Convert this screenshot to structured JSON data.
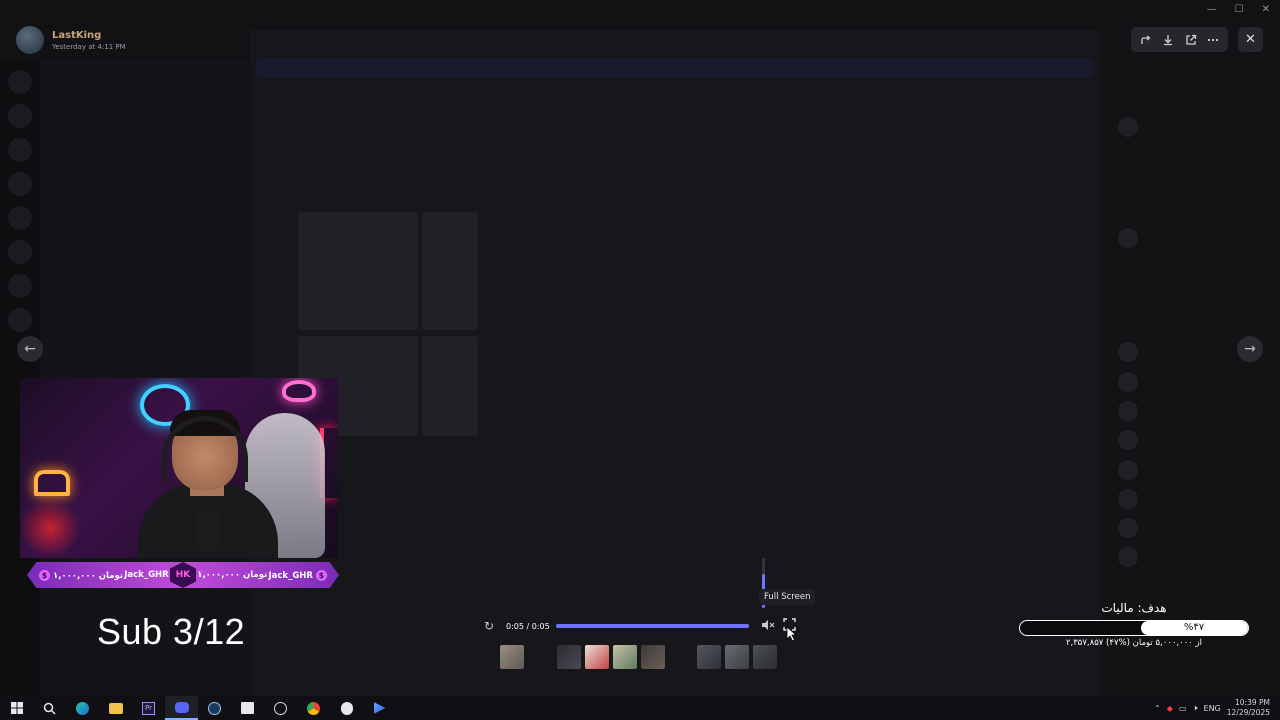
{
  "author": {
    "name": "LastKing",
    "timestamp": "Yesterday at 4:11 PM"
  },
  "toolbar": {
    "icons": [
      "forward-icon",
      "download-icon",
      "open-external-icon",
      "more-icon"
    ],
    "close_glyph": "✕"
  },
  "window_controls": {
    "minimize": "—",
    "maximize": "☐",
    "close": "✕"
  },
  "nav": {
    "prev_glyph": "←",
    "next_glyph": "→"
  },
  "stream_overlay": {
    "ticker": {
      "left_amount": "۱,۰۰۰,۰۰۰ تومان",
      "left_name": "Jack_GHR",
      "logo": "HK",
      "right_amount": "۱,۰۰۰,۰۰۰ تومان",
      "right_name": "Jack_GHR",
      "coin": "$"
    },
    "sub_counter": "Sub 3/12"
  },
  "video": {
    "time": "0:05 / 0:05",
    "progress": 1.0,
    "volume": 0.68,
    "tooltip": "Full Screen",
    "replay_glyph": "↻",
    "mute_glyph": "🔇",
    "fullscreen_glyph": "⛶"
  },
  "goal": {
    "title": "هدف: مالیات",
    "percent_label": "%۴۷",
    "fraction": 0.47,
    "detail": "۲,۳۵۷,۸۵۷ از ۵,۰۰۰,۰۰۰ تومان (%۴۷)"
  },
  "taskbar": {
    "apps": [
      "start",
      "search",
      "edge",
      "explorer",
      "premiere",
      "discord",
      "steam",
      "store",
      "obs",
      "chrome",
      "app",
      "app2"
    ],
    "language": "ENG",
    "time": "10:39 PM",
    "date": "12/29/2025"
  },
  "colors": {
    "accent": "#6f73ff",
    "ticker": "#c24bd9"
  }
}
